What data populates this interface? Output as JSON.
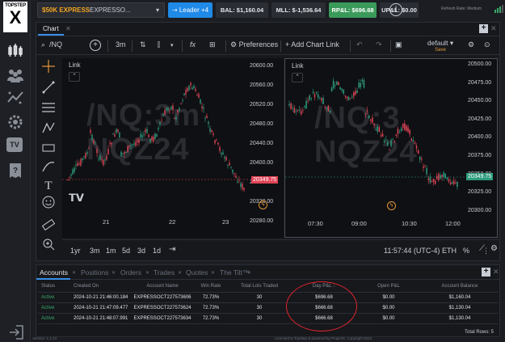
{
  "sidebar": {
    "logo_top": "TOPSTEP",
    "logo_bottom": "X",
    "tv_label": "TV"
  },
  "topbar": {
    "account_tag": "$50K EXPRESS",
    "account_name": "EXPRESSO...",
    "leader_label": "Leader +4",
    "bal": "BAL: $1,160.04",
    "mll": "MLL: $-1,536.64",
    "rpl": "RP&L: $696.68",
    "upl": "UP&L: $0.00",
    "refresh_text": "Refresh Rate: Medium"
  },
  "chart_panel": {
    "tab_label": "Chart",
    "symbol": "/NQ",
    "interval": "3m",
    "preferences_label": "Preferences",
    "add_chart_label": "Add Chart Link",
    "layout_name": "default",
    "layout_save": "Save"
  },
  "chart_left": {
    "title": "Link",
    "watermark_1": "/NQ:3m",
    "watermark_2": "NQZ24",
    "price_labels": [
      "20600.00",
      "20560.00",
      "20520.00",
      "20480.00",
      "20440.00",
      "20400.00",
      "20360.00",
      "20320.00",
      "20280.00"
    ],
    "current_price": "20349.75",
    "dates": [
      "21",
      "22",
      "23"
    ]
  },
  "chart_right": {
    "title": "Link",
    "watermark_1": "/NQ:3",
    "watermark_2": "NQZ24",
    "price_labels": [
      "20500.00",
      "20475.00",
      "20450.00",
      "20425.00",
      "20400.00",
      "20375.00",
      "20350.00",
      "20325.00",
      "20300.00"
    ],
    "current_price": "20349.75",
    "times": [
      "07:30",
      "09:00",
      "10:30",
      "12:00"
    ]
  },
  "chart_bottom": {
    "ranges": [
      "1yr",
      "3m",
      "1m",
      "5d",
      "3d",
      "1d"
    ],
    "clock": "11:57:44 (UTC-4)",
    "session": "ETH",
    "pct": "%"
  },
  "accounts": {
    "tabs": [
      "Accounts",
      "Positions",
      "Orders",
      "Trades",
      "Quotes",
      "The Tilt™"
    ],
    "columns": [
      "Status",
      "Created On",
      "Account Name",
      "Win Rate",
      "Total Lots Traded",
      "Day P&L",
      "Open P&L",
      "Account Balance"
    ],
    "rows": [
      [
        "Active",
        "2024-10-21 21:46:00.184",
        "EXPRESSOCT227573606",
        "72.73%",
        "30",
        "$696.68",
        "$0.00",
        "$1,160.04"
      ],
      [
        "Active",
        "2024-10-21 21:47:09.477",
        "EXPRESSOCT227573624",
        "72.73%",
        "30",
        "$666.68",
        "$0.00",
        "$1,130.04"
      ],
      [
        "Active",
        "2024-10-21 21:48:07.991",
        "EXPRESSOCT227573634",
        "72.73%",
        "30",
        "$666.68",
        "$0.00",
        "$1,130.04"
      ]
    ],
    "total_rows": "Total Rows: 5"
  },
  "footer": {
    "version": "Version: 1.4.13",
    "license": "Licensed to Topstep & powered by ProjectX. Copyright 2024"
  },
  "colors": {
    "up": "#2e9c7e",
    "down": "#e04456",
    "accent": "#1f8ae8",
    "express": "#f5a623",
    "annotation": "#e0242c"
  }
}
